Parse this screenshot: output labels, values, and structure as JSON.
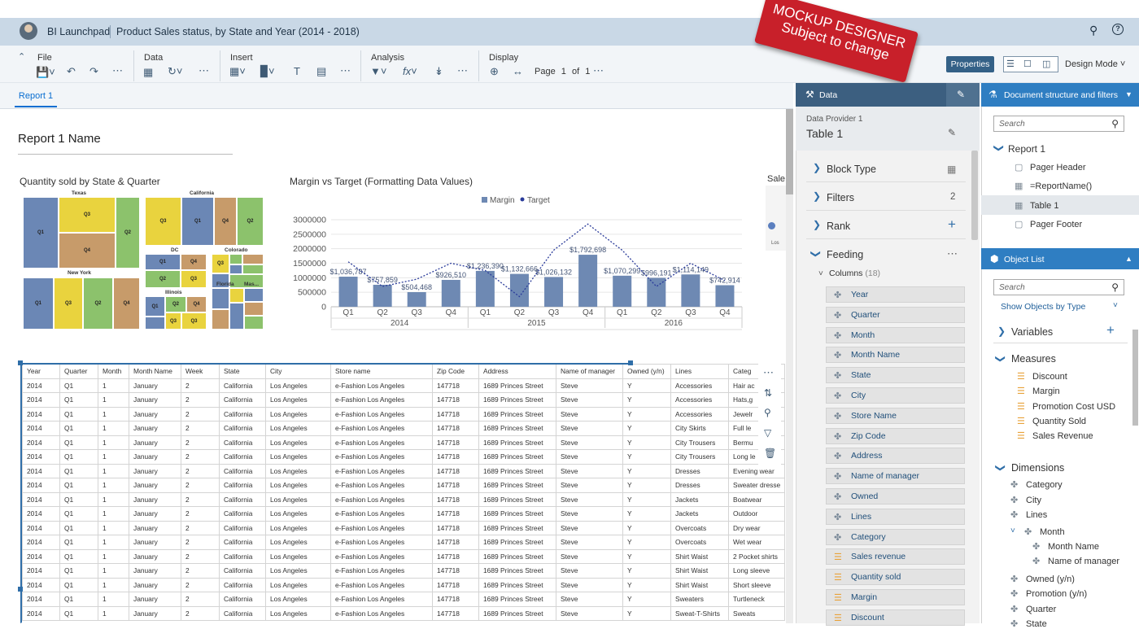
{
  "shell": {
    "app_name": "BI Launchpad",
    "doc_title": "Product Sales status, by State and Year (2014 - 2018)"
  },
  "stamp": {
    "line1": "MOCKUP DESIGNER",
    "line2": "Subject to change"
  },
  "toolbar": {
    "file": "File",
    "data": "Data",
    "insert": "Insert",
    "analysis": "Analysis",
    "display": "Display",
    "page_label": "Page",
    "page_current": "1",
    "page_of": "of",
    "page_total": "1",
    "properties": "Properties",
    "design_mode": "Design Mode"
  },
  "tabs": {
    "report1": "Report 1"
  },
  "report": {
    "name": "Report 1 Name",
    "truncated_chart_title": "Sale",
    "truncated_axis": "Los"
  },
  "treemap": {
    "title": "Quantity sold by State & Quarter",
    "groups": [
      "Texas",
      "California",
      "New York",
      "DC",
      "Colorado",
      "Illinois",
      "Florida",
      "Mas..."
    ],
    "colors": {
      "q1": "#6b87b5",
      "q2": "#8cc26c",
      "q3": "#e9d33e",
      "q4": "#c79b6a"
    }
  },
  "chart_data": {
    "type": "bar",
    "title": "Margin vs Target (Formatting Data Values)",
    "legend": [
      "Margin",
      "Target"
    ],
    "legend_position": "top",
    "categories": [
      "Q1",
      "Q2",
      "Q3",
      "Q4",
      "Q1",
      "Q2",
      "Q3",
      "Q4",
      "Q1",
      "Q2",
      "Q3",
      "Q4"
    ],
    "years": [
      "2014",
      "2015",
      "2016"
    ],
    "series": [
      {
        "name": "Margin",
        "type": "bar",
        "values": [
          1036787,
          757859,
          504468,
          926510,
          1236390,
          1132666,
          1026132,
          1792698,
          1070299,
          996191,
          1114149,
          742914
        ],
        "labels": [
          "$1,036,787",
          "$757,859",
          "$504,468",
          "$926,510",
          "$1,236,390",
          "$1,132,666",
          "$1,026,132",
          "$1,792,698",
          "$1,070,299",
          "$996,191",
          "$1,114,149",
          "$742,914"
        ]
      },
      {
        "name": "Target",
        "type": "line",
        "values": [
          1550000,
          700000,
          950000,
          1500000,
          1250000,
          350000,
          1950000,
          2850000,
          1950000,
          700000,
          1500000,
          900000
        ]
      }
    ],
    "ylim": [
      0,
      3000000
    ],
    "yticks": [
      "0",
      "500000",
      "1000000",
      "1500000",
      "2000000",
      "2500000",
      "3000000"
    ],
    "grid": true,
    "colors": {
      "bar": "#6e89b3",
      "line": "#2a3b9a"
    }
  },
  "table": {
    "headers": [
      "Year",
      "Quarter",
      "Month",
      "Month Name",
      "Week",
      "State",
      "City",
      "Store name",
      "Zip Code",
      "Address",
      "Name of manager",
      "Owned (y/n)",
      "Lines",
      "Categ"
    ],
    "rows": [
      [
        "2014",
        "Q1",
        "1",
        "January",
        "2",
        "California",
        "Los Angeles",
        "e-Fashion Los Angeles",
        "147718",
        "1689 Princes Street",
        "Steve",
        "Y",
        "Accessories",
        "Hair ac"
      ],
      [
        "2014",
        "Q1",
        "1",
        "January",
        "2",
        "California",
        "Los Angeles",
        "e-Fashion Los Angeles",
        "147718",
        "1689 Princes Street",
        "Steve",
        "Y",
        "Accessories",
        "Hats,g"
      ],
      [
        "2014",
        "Q1",
        "1",
        "January",
        "2",
        "California",
        "Los Angeles",
        "e-Fashion Los Angeles",
        "147718",
        "1689 Princes Street",
        "Steve",
        "Y",
        "Accessories",
        "Jewelr"
      ],
      [
        "2014",
        "Q1",
        "1",
        "January",
        "2",
        "California",
        "Los Angeles",
        "e-Fashion Los Angeles",
        "147718",
        "1689 Princes Street",
        "Steve",
        "Y",
        "City Skirts",
        "Full le"
      ],
      [
        "2014",
        "Q1",
        "1",
        "January",
        "2",
        "California",
        "Los Angeles",
        "e-Fashion Los Angeles",
        "147718",
        "1689 Princes Street",
        "Steve",
        "Y",
        "City Trousers",
        "Bermu"
      ],
      [
        "2014",
        "Q1",
        "1",
        "January",
        "2",
        "California",
        "Los Angeles",
        "e-Fashion Los Angeles",
        "147718",
        "1689 Princes Street",
        "Steve",
        "Y",
        "City Trousers",
        "Long le"
      ],
      [
        "2014",
        "Q1",
        "1",
        "January",
        "2",
        "California",
        "Los Angeles",
        "e-Fashion Los Angeles",
        "147718",
        "1689 Princes Street",
        "Steve",
        "Y",
        "Dresses",
        "Evening wear"
      ],
      [
        "2014",
        "Q1",
        "1",
        "January",
        "2",
        "California",
        "Los Angeles",
        "e-Fashion Los Angeles",
        "147718",
        "1689 Princes Street",
        "Steve",
        "Y",
        "Dresses",
        "Sweater dresse"
      ],
      [
        "2014",
        "Q1",
        "1",
        "January",
        "2",
        "California",
        "Los Angeles",
        "e-Fashion Los Angeles",
        "147718",
        "1689 Princes Street",
        "Steve",
        "Y",
        "Jackets",
        "Boatwear"
      ],
      [
        "2014",
        "Q1",
        "1",
        "January",
        "2",
        "California",
        "Los Angeles",
        "e-Fashion Los Angeles",
        "147718",
        "1689 Princes Street",
        "Steve",
        "Y",
        "Jackets",
        "Outdoor"
      ],
      [
        "2014",
        "Q1",
        "1",
        "January",
        "2",
        "California",
        "Los Angeles",
        "e-Fashion Los Angeles",
        "147718",
        "1689 Princes Street",
        "Steve",
        "Y",
        "Overcoats",
        "Dry wear"
      ],
      [
        "2014",
        "Q1",
        "1",
        "January",
        "2",
        "California",
        "Los Angeles",
        "e-Fashion Los Angeles",
        "147718",
        "1689 Princes Street",
        "Steve",
        "Y",
        "Overcoats",
        "Wet wear"
      ],
      [
        "2014",
        "Q1",
        "1",
        "January",
        "2",
        "California",
        "Los Angeles",
        "e-Fashion Los Angeles",
        "147718",
        "1689 Princes Street",
        "Steve",
        "Y",
        "Shirt Waist",
        "2 Pocket shirts"
      ],
      [
        "2014",
        "Q1",
        "1",
        "January",
        "2",
        "California",
        "Los Angeles",
        "e-Fashion Los Angeles",
        "147718",
        "1689 Princes Street",
        "Steve",
        "Y",
        "Shirt Waist",
        "Long sleeve"
      ],
      [
        "2014",
        "Q1",
        "1",
        "January",
        "2",
        "California",
        "Los Angeles",
        "e-Fashion Los Angeles",
        "147718",
        "1689 Princes Street",
        "Steve",
        "Y",
        "Shirt Waist",
        "Short sleeve"
      ],
      [
        "2014",
        "Q1",
        "1",
        "January",
        "2",
        "California",
        "Los Angeles",
        "e-Fashion Los Angeles",
        "147718",
        "1689 Princes Street",
        "Steve",
        "Y",
        "Sweaters",
        "Turtleneck"
      ],
      [
        "2014",
        "Q1",
        "1",
        "January",
        "2",
        "California",
        "Los Angeles",
        "e-Fashion Los Angeles",
        "147718",
        "1689 Princes Street",
        "Steve",
        "Y",
        "Sweat-T-Shirts",
        "Sweats"
      ]
    ]
  },
  "data_panel": {
    "title": "Data",
    "provider": "Data Provider 1",
    "table_name": "Table 1",
    "block_type": "Block Type",
    "filters": "Filters",
    "filters_count": "2",
    "rank": "Rank",
    "feeding": "Feeding",
    "columns_label": "Columns",
    "columns_count": "(18)",
    "fields": [
      {
        "label": "Year",
        "kind": "dimension"
      },
      {
        "label": "Quarter",
        "kind": "dimension"
      },
      {
        "label": "Month",
        "kind": "dimension"
      },
      {
        "label": "Month Name",
        "kind": "dimension"
      },
      {
        "label": "State",
        "kind": "dimension"
      },
      {
        "label": "City",
        "kind": "dimension"
      },
      {
        "label": "Store Name",
        "kind": "dimension"
      },
      {
        "label": "Zip Code",
        "kind": "dimension"
      },
      {
        "label": "Address",
        "kind": "dimension"
      },
      {
        "label": "Name of manager",
        "kind": "dimension"
      },
      {
        "label": "Owned",
        "kind": "dimension"
      },
      {
        "label": "Lines",
        "kind": "dimension"
      },
      {
        "label": "Category",
        "kind": "dimension"
      },
      {
        "label": "Sales revenue",
        "kind": "measure"
      },
      {
        "label": "Quantity sold",
        "kind": "measure"
      },
      {
        "label": "Margin",
        "kind": "measure"
      },
      {
        "label": "Discount",
        "kind": "measure"
      }
    ]
  },
  "doc_panel": {
    "title": "Document structure and filters",
    "search_placeholder": "Search",
    "report": "Report 1",
    "items": [
      "Pager Header",
      "=ReportName()",
      "Table 1",
      "Pager Footer"
    ]
  },
  "object_list": {
    "title": "Object List",
    "search_placeholder": "Search",
    "show_by": "Show Objects by Type",
    "variables": "Variables",
    "measures_label": "Measures",
    "measures": [
      "Discount",
      "Margin",
      "Promotion Cost USD",
      "Quantity Sold",
      "Sales Revenue"
    ],
    "dimensions_label": "Dimensions",
    "dimensions": [
      "Category",
      "City",
      "Lines"
    ],
    "month": "Month",
    "month_children": [
      "Month Name",
      "Name of manager"
    ],
    "dimensions_after": [
      "Owned (y/n)",
      "Promotion (y/n)",
      "Quarter",
      "State"
    ]
  }
}
